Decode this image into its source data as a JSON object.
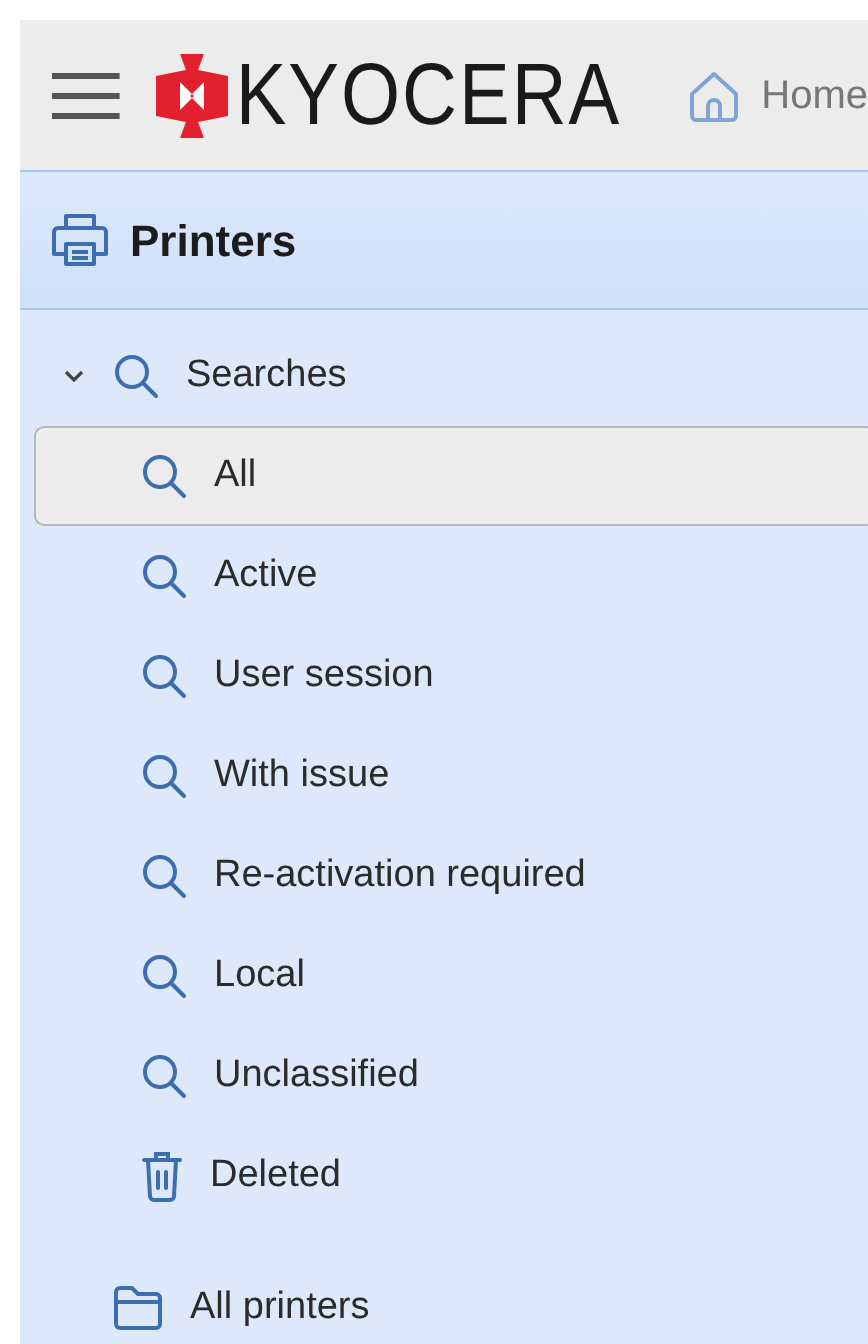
{
  "header": {
    "brand": "KYOCERA",
    "home_link": "Home"
  },
  "panel": {
    "title": "Printers"
  },
  "tree": [
    {
      "label": "Searches",
      "kind": "search",
      "expanded": true,
      "selected": false,
      "children": [
        {
          "label": "All",
          "kind": "search",
          "selected": true
        },
        {
          "label": "Active",
          "kind": "search",
          "selected": false
        },
        {
          "label": "User session",
          "kind": "search",
          "selected": false
        },
        {
          "label": "With issue",
          "kind": "search",
          "selected": false
        },
        {
          "label": "Re-activation required",
          "kind": "search",
          "selected": false
        },
        {
          "label": "Local",
          "kind": "search",
          "selected": false
        },
        {
          "label": "Unclassified",
          "kind": "search",
          "selected": false
        },
        {
          "label": "Deleted",
          "kind": "trash",
          "selected": false
        }
      ]
    },
    {
      "label": "All printers",
      "kind": "folder",
      "selected": false
    }
  ]
}
